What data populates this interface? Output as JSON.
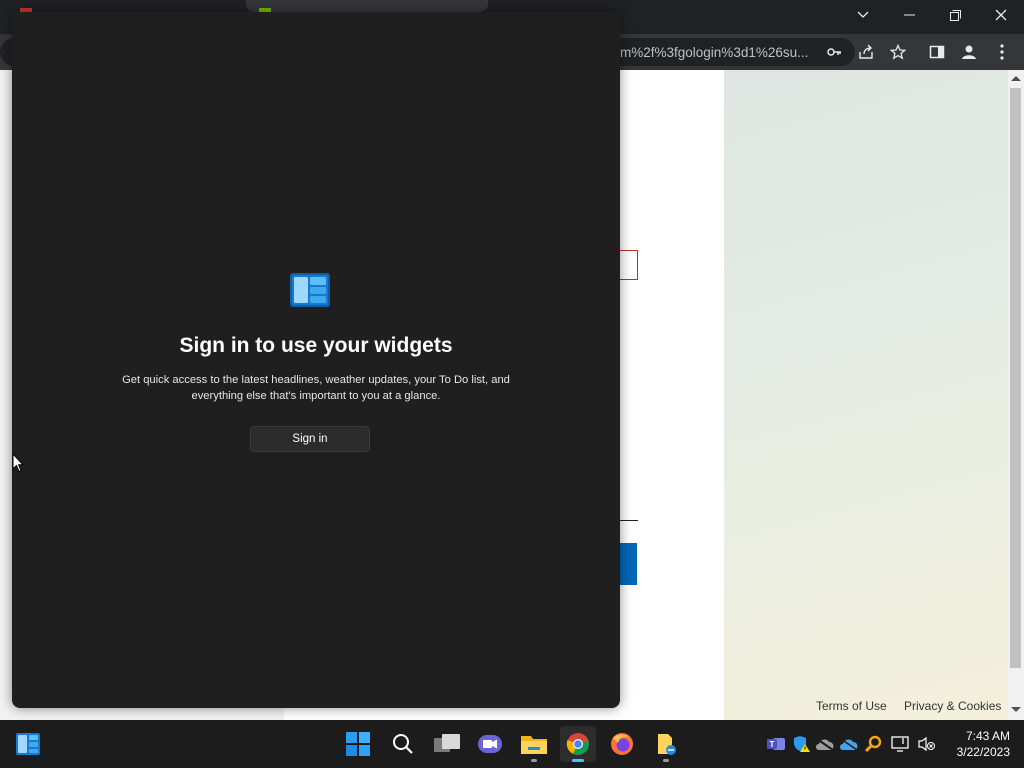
{
  "browser": {
    "address_bar_text": "m%2f%3fgologin%3d1%26su...",
    "window_controls": [
      "tab-search",
      "minimize",
      "restore",
      "close"
    ]
  },
  "page": {
    "footer": {
      "terms_label": "Terms of Use",
      "privacy_label": "Privacy & Cookies"
    }
  },
  "widgets": {
    "title": "Sign in to use your widgets",
    "description_line1": "Get quick access to the latest headlines, weather updates, your To Do list, and",
    "description_line2": "everything else that's important to you at a glance.",
    "signin_label": "Sign in"
  },
  "taskbar": {
    "apps": [
      "widgets",
      "start",
      "search",
      "task-view",
      "teams-chat",
      "file-explorer",
      "chrome",
      "firefox",
      "notepad-folder"
    ],
    "active_app": "chrome",
    "tray_icons": [
      "teams",
      "defender",
      "network",
      "onedrive",
      "search-tool",
      "display",
      "volume-muted"
    ],
    "time": "7:43 AM",
    "date": "3/22/2023"
  },
  "colors": {
    "panel_bg": "#1f1f1f",
    "taskbar_bg": "#1c1c1c",
    "accent_blue": "#0067b8",
    "error_red": "#c42b1c"
  }
}
